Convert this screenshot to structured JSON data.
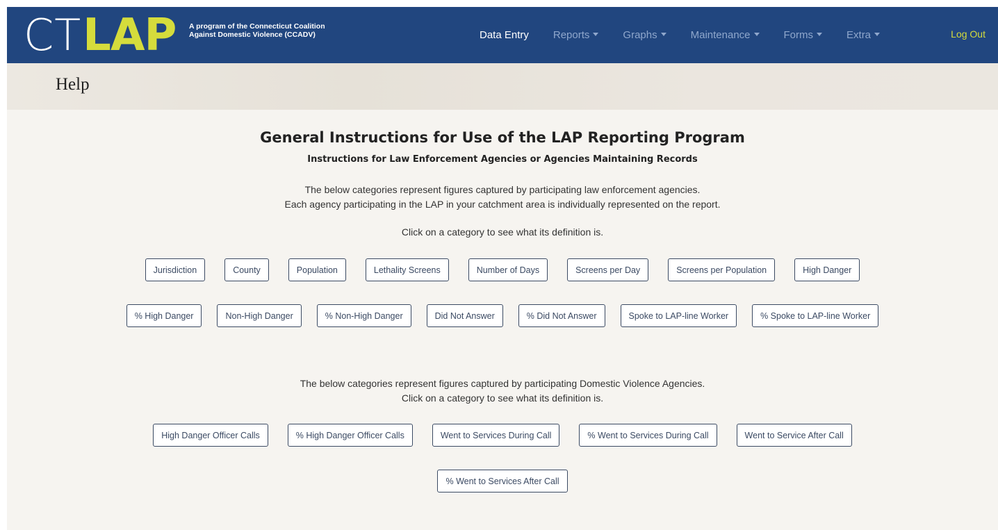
{
  "brand": {
    "logo_ct": "CT",
    "logo_lap": "LAP",
    "tagline_line1": "A program of the Connecticut Coalition",
    "tagline_line2": "Against Domestic Violence (CCADV)"
  },
  "nav": {
    "items": [
      {
        "label": "Data Entry",
        "active": true,
        "dropdown": false
      },
      {
        "label": "Reports",
        "active": false,
        "dropdown": true
      },
      {
        "label": "Graphs",
        "active": false,
        "dropdown": true
      },
      {
        "label": "Maintenance",
        "active": false,
        "dropdown": true
      },
      {
        "label": "Forms",
        "active": false,
        "dropdown": true
      },
      {
        "label": "Extra",
        "active": false,
        "dropdown": true
      }
    ],
    "logout": "Log Out"
  },
  "page": {
    "title": "Help",
    "main_title": "General Instructions for Use of the LAP Reporting Program",
    "sub_title": "Instructions for Law Enforcement Agencies or Agencies Maintaining Records",
    "le_intro_line1": "The below categories represent figures captured by participating law enforcement agencies.",
    "le_intro_line2": "Each agency participating in the LAP in your catchment area is individually represented on the report.",
    "le_click_hint": "Click on a category to see what its definition is.",
    "dv_intro_line1": "The below categories represent figures captured by participating Domestic Violence Agencies.",
    "dv_intro_line2": "Click on a category to see what its definition is."
  },
  "le_categories_row1": [
    "Jurisdiction",
    "County",
    "Population",
    "Lethality Screens",
    "Number of Days",
    "Screens per Day",
    "Screens per Population",
    "High Danger"
  ],
  "le_categories_row2": [
    "% High Danger",
    "Non-High Danger",
    "% Non-High Danger",
    "Did Not Answer",
    "% Did Not Answer",
    "Spoke to LAP-line Worker",
    "% Spoke to LAP-line Worker"
  ],
  "dv_categories_row1": [
    "High Danger Officer Calls",
    "% High Danger Officer Calls",
    "Went to Services During Call",
    "% Went to Services During Call",
    "Went to Service After Call"
  ],
  "dv_categories_row2": [
    "% Went to Services After Call"
  ],
  "colors": {
    "navbar": "#21467f",
    "accent": "#d5dc3c",
    "nav_inactive": "#8fa7cc",
    "button_border": "#3b4a63"
  }
}
